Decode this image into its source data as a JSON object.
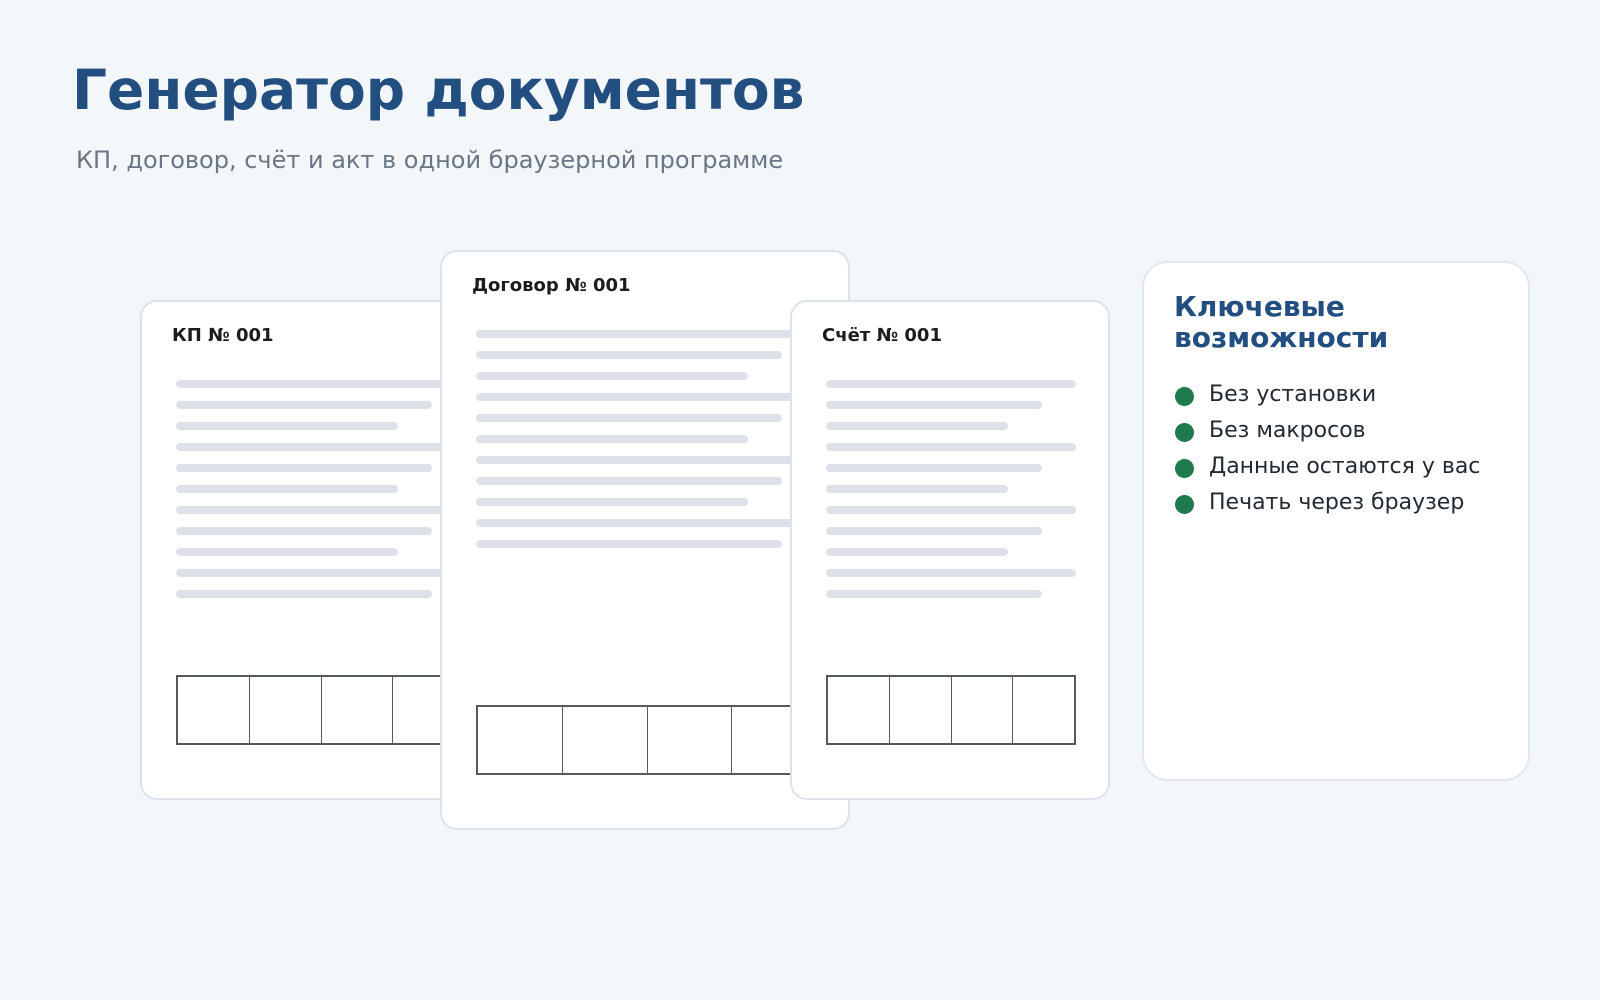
{
  "page": {
    "title": "Генератор документов",
    "subtitle": "КП, договор, счёт и акт в одной браузерной программе"
  },
  "documents": [
    {
      "title": "КП № 001"
    },
    {
      "title": "Договор № 001"
    },
    {
      "title": "Счёт № 001"
    }
  ],
  "features": {
    "title": "Ключевые возможности",
    "items": [
      "Без установки",
      "Без макросов",
      "Данные остаются у вас",
      "Печать через браузер"
    ]
  },
  "colors": {
    "accent": "#234e80",
    "bullet": "#1f7a4e",
    "background": "#f4f7fa"
  }
}
